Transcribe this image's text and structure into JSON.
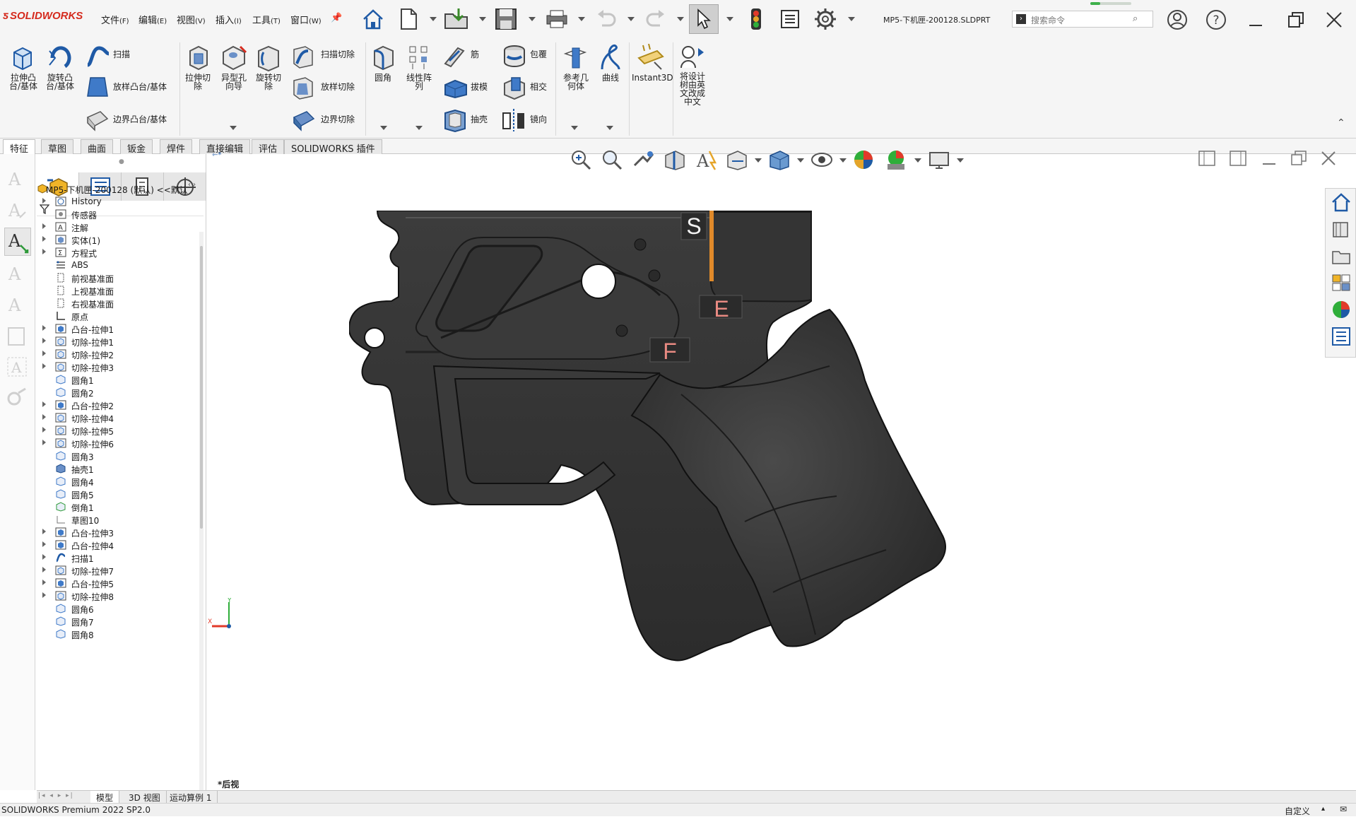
{
  "app": {
    "logo_text": "SOLIDWORKS",
    "doc_title": "MP5-下机匣-200128.SLDPRT",
    "search_placeholder": "搜索命令"
  },
  "menus": [
    {
      "label": "文件",
      "key": "(F)"
    },
    {
      "label": "编辑",
      "key": "(E)"
    },
    {
      "label": "视图",
      "key": "(V)"
    },
    {
      "label": "插入",
      "key": "(I)"
    },
    {
      "label": "工具",
      "key": "(T)"
    },
    {
      "label": "窗口",
      "key": "(W)"
    }
  ],
  "ribbon": {
    "extrude_boss": "拉伸凸\n台/基体",
    "revolve_boss": "旋转凸\n台/基体",
    "sweep": "扫描",
    "loft_boss": "放样凸台/基体",
    "boundary_boss": "边界凸台/基体",
    "extrude_cut": "拉伸切\n除",
    "hole_wizard": "异型孔\n向导",
    "revolve_cut": "旋转切\n除",
    "swept_cut": "扫描切除",
    "lofted_cut": "放样切除",
    "boundary_cut": "边界切除",
    "fillet": "圆角",
    "linear_pattern": "线性阵\n列",
    "rib": "筋",
    "draft": "拔模",
    "shell": "抽壳",
    "wrap": "包覆",
    "intersect": "相交",
    "mirror": "镜向",
    "ref_geometry": "参考几\n何体",
    "curves": "曲线",
    "instant3d": "Instant3D",
    "translate_tree": "将设计\n树由英\n文改成\n中文"
  },
  "command_tabs": [
    "特征",
    "草图",
    "曲面",
    "钣金",
    "焊件",
    "直接编辑",
    "评估",
    "SOLIDWORKS 插件"
  ],
  "tree": {
    "root": "MP5-下机匣-200128 (默认) <<默认",
    "items": [
      {
        "label": "History",
        "expand": true,
        "icon": "history-icon"
      },
      {
        "label": "传感器",
        "expand": false,
        "icon": "sensor-icon"
      },
      {
        "label": "注解",
        "expand": true,
        "icon": "annotation-icon"
      },
      {
        "label": "实体(1)",
        "expand": true,
        "icon": "solid-body-icon"
      },
      {
        "label": "方程式",
        "expand": true,
        "icon": "equation-icon"
      },
      {
        "label": "ABS",
        "expand": false,
        "icon": "material-icon"
      },
      {
        "label": "前视基准面",
        "expand": false,
        "icon": "plane-icon"
      },
      {
        "label": "上视基准面",
        "expand": false,
        "icon": "plane-icon"
      },
      {
        "label": "右视基准面",
        "expand": false,
        "icon": "plane-icon"
      },
      {
        "label": "原点",
        "expand": false,
        "icon": "origin-icon"
      },
      {
        "label": "凸台-拉伸1",
        "expand": true,
        "icon": "extrude-icon"
      },
      {
        "label": "切除-拉伸1",
        "expand": true,
        "icon": "cut-icon"
      },
      {
        "label": "切除-拉伸2",
        "expand": true,
        "icon": "cut-icon"
      },
      {
        "label": "切除-拉伸3",
        "expand": true,
        "icon": "cut-icon"
      },
      {
        "label": "圆角1",
        "expand": false,
        "icon": "fillet-icon"
      },
      {
        "label": "圆角2",
        "expand": false,
        "icon": "fillet-icon"
      },
      {
        "label": "凸台-拉伸2",
        "expand": true,
        "icon": "extrude-icon"
      },
      {
        "label": "切除-拉伸4",
        "expand": true,
        "icon": "cut-icon"
      },
      {
        "label": "切除-拉伸5",
        "expand": true,
        "icon": "cut-icon"
      },
      {
        "label": "切除-拉伸6",
        "expand": true,
        "icon": "cut-icon"
      },
      {
        "label": "圆角3",
        "expand": false,
        "icon": "fillet-icon"
      },
      {
        "label": "抽壳1",
        "expand": false,
        "icon": "shell-icon"
      },
      {
        "label": "圆角4",
        "expand": false,
        "icon": "fillet-icon"
      },
      {
        "label": "圆角5",
        "expand": false,
        "icon": "fillet-icon"
      },
      {
        "label": "倒角1",
        "expand": false,
        "icon": "chamfer-icon"
      },
      {
        "label": "草图10",
        "expand": false,
        "icon": "sketch-icon"
      },
      {
        "label": "凸台-拉伸3",
        "expand": true,
        "icon": "extrude-icon"
      },
      {
        "label": "凸台-拉伸4",
        "expand": true,
        "icon": "extrude-icon"
      },
      {
        "label": "扫描1",
        "expand": true,
        "icon": "sweep-icon"
      },
      {
        "label": "切除-拉伸7",
        "expand": true,
        "icon": "cut-icon"
      },
      {
        "label": "凸台-拉伸5",
        "expand": true,
        "icon": "extrude-icon"
      },
      {
        "label": "切除-拉伸8",
        "expand": true,
        "icon": "cut-icon"
      },
      {
        "label": "圆角6",
        "expand": false,
        "icon": "fillet-icon"
      },
      {
        "label": "圆角7",
        "expand": false,
        "icon": "fillet-icon"
      },
      {
        "label": "圆角8",
        "expand": false,
        "icon": "fillet-icon"
      }
    ]
  },
  "bottom_tabs": [
    "模型",
    "3D 视图",
    "运动算例 1"
  ],
  "status": {
    "left": "SOLIDWORKS Premium 2022 SP2.0",
    "units": "自定义"
  },
  "viewport": {
    "view_name": "*后视",
    "axis_x": "X",
    "axis_y": "Y",
    "engrave_s": "S",
    "engrave_e": "E",
    "engrave_f": "F"
  },
  "colors": {
    "brand": "#d52b1e",
    "model_dark": "#3a3a3a",
    "engrave_red": "#e88a82",
    "accent_orange": "#e08a2a"
  }
}
